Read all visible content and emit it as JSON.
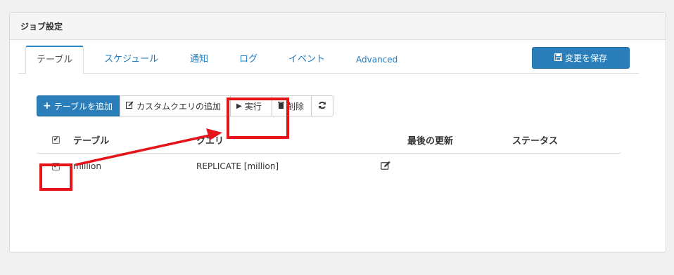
{
  "panel": {
    "title": "ジョブ設定"
  },
  "tabs": [
    {
      "label": "テーブル",
      "active": true
    },
    {
      "label": "スケジュール",
      "active": false
    },
    {
      "label": "通知",
      "active": false
    },
    {
      "label": "ログ",
      "active": false
    },
    {
      "label": "イベント",
      "active": false
    },
    {
      "label": "Advanced",
      "active": false
    }
  ],
  "save_button": {
    "label": "変更を保存",
    "icon": "save-icon"
  },
  "toolbar": {
    "add_table": "テーブルを追加",
    "add_custom_query": "カスタムクエリの追加",
    "run": "実行",
    "delete": "削除",
    "refresh_icon": "refresh-icon"
  },
  "table": {
    "headers": {
      "table": "テーブル",
      "query": "クエリ",
      "last_updated": "最後の更新",
      "status": "ステータス"
    },
    "header_checkbox_checked": true,
    "rows": [
      {
        "checked": true,
        "table": "million",
        "query": "REPLICATE [million]",
        "last_updated": "",
        "status": ""
      }
    ]
  },
  "colors": {
    "primary": "#2a7fba",
    "link": "#1f7bbd",
    "annotation": "#e5141b"
  }
}
